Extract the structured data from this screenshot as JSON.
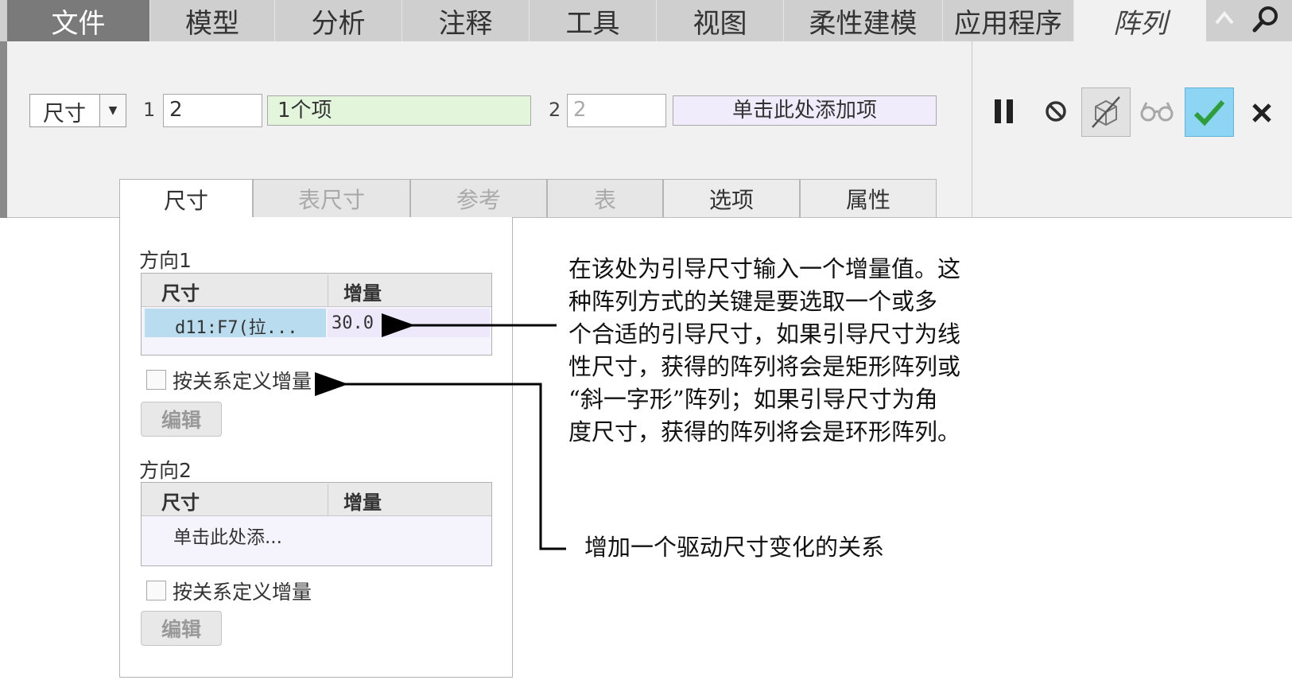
{
  "menu_tabs": [
    "文件",
    "模型",
    "分析",
    "注释",
    "工具",
    "视图",
    "柔性建模",
    "应用程序",
    "阵列"
  ],
  "dashboard": {
    "type_select": "尺寸",
    "dir1_num": "1",
    "dir1_count": "2",
    "dir1_items": "1个项",
    "dir2_num": "2",
    "dir2_count": "2",
    "dir2_items": "单击此处添加项"
  },
  "sub_tabs": [
    "尺寸",
    "表尺寸",
    "参考",
    "表",
    "选项",
    "属性"
  ],
  "panel": {
    "dir1_label": "方向1",
    "col_dimension": "尺寸",
    "col_increment": "增量",
    "dir1_row_dim": "d11:F7(拉...",
    "dir1_row_inc": "30.0",
    "relation_checkbox": "按关系定义增量",
    "edit_button": "编辑",
    "dir2_label": "方向2",
    "dir2_row_dim": "单击此处添..."
  },
  "annotations": {
    "increment_note_lines": [
      "在该处为引导尺寸输入一个增量值。这",
      "种阵列方式的关键是要选取一个或多",
      "个合适的引导尺寸，如果引导尺寸为线",
      "性尺寸，获得的阵列将会是矩形阵列或",
      "“斜一字形”阵列；如果引导尺寸为角",
      "度尺寸，获得的阵列将会是环形阵列。"
    ],
    "relation_note": "增加一个驱动尺寸变化的关系"
  },
  "colors": {
    "active_tab": "#f1f1f1",
    "file_tab": "#7a7a7a",
    "items_green": "#e3f6dc",
    "add_items_purple": "#f0ecfc",
    "confirm_blue": "#8ed5f3",
    "confirm_check": "#2f9e3a"
  }
}
